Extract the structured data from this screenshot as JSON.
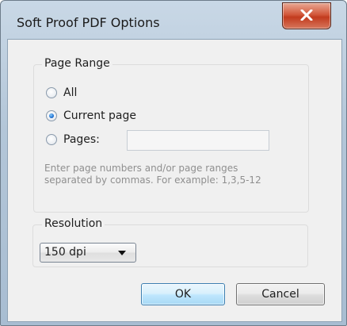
{
  "window": {
    "title": "Soft Proof PDF Options"
  },
  "page_range": {
    "legend": "Page Range",
    "options": [
      {
        "label": "All",
        "checked": false
      },
      {
        "label": "Current page",
        "checked": true
      },
      {
        "label": "Pages:",
        "checked": false
      }
    ],
    "pages_value": "",
    "hint_line1": "Enter page numbers and/or page ranges",
    "hint_line2": "separated by commas.  For example: 1,3,5-12"
  },
  "resolution": {
    "legend": "Resolution",
    "selected": "150 dpi"
  },
  "buttons": {
    "ok": "OK",
    "cancel": "Cancel"
  },
  "icons": {
    "close": "close-icon",
    "dropdown": "chevron-down-icon"
  },
  "colors": {
    "title_bar": "#b3c6d8",
    "close_button": "#c23b1e",
    "dialog_background": "#f0f0f0",
    "selected_radio": "#1e6fd0",
    "ok_button": "#bee6fd",
    "hint_text": "#8f8f8f"
  }
}
